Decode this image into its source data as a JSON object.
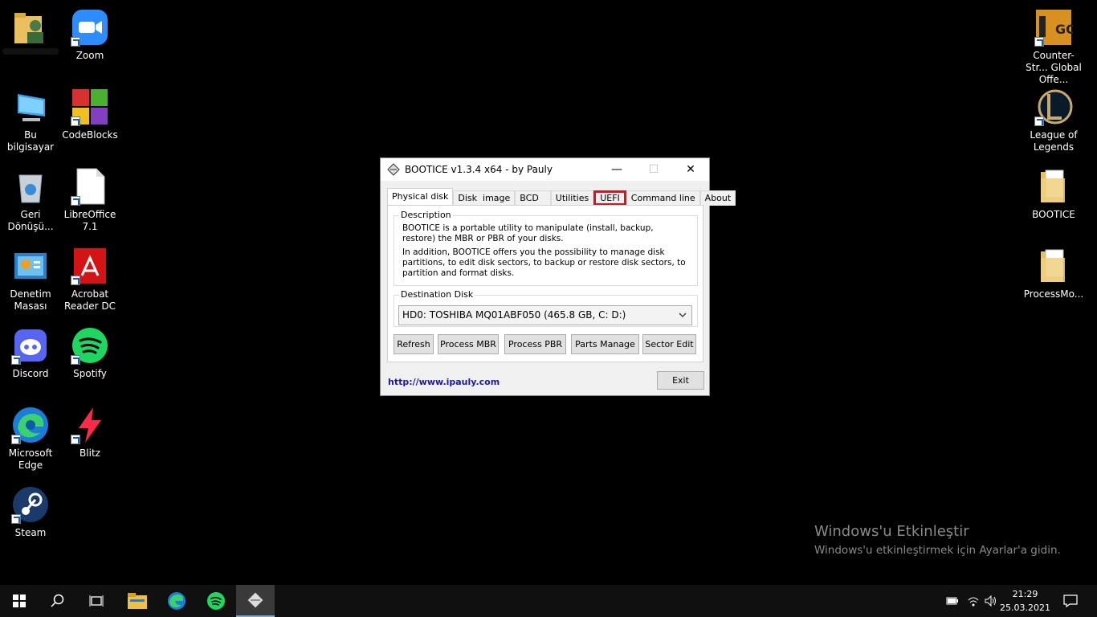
{
  "desktop_icons_left": [
    {
      "label": ""
    },
    {
      "label": "Zoom"
    },
    {
      "label": "Bu bilgisayar"
    },
    {
      "label": "CodeBlocks"
    },
    {
      "label": "Geri Dönüşü..."
    },
    {
      "label": "LibreOffice 7.1"
    },
    {
      "label": "Denetim Masası"
    },
    {
      "label": "Acrobat Reader DC"
    },
    {
      "label": "Discord"
    },
    {
      "label": "Spotify"
    },
    {
      "label": "Microsoft Edge"
    },
    {
      "label": "Blitz"
    },
    {
      "label": "Steam"
    }
  ],
  "desktop_icons_right": [
    {
      "label": "Counter-Str... Global Offe..."
    },
    {
      "label": "League of Legends"
    },
    {
      "label": "BOOTICE"
    },
    {
      "label": "ProcessMo..."
    }
  ],
  "window": {
    "title": "BOOTICE v1.3.4 x64 - by Pauly",
    "tabs": [
      {
        "label": "Physical disk"
      },
      {
        "label": "Disk  image"
      },
      {
        "label": "BCD"
      },
      {
        "label": "Utilities"
      },
      {
        "label": "UEFI"
      },
      {
        "label": "Command line"
      },
      {
        "label": "About"
      }
    ],
    "description_legend": "Description",
    "description_p1": "BOOTICE is a portable utility to manipulate (install, backup, restore) the MBR or PBR of your disks.",
    "description_p2": "In addition, BOOTICE offers you the possibility to manage disk partitions, to edit disk sectors, to backup or restore disk sectors, to partition and format disks.",
    "destination_legend": "Destination Disk",
    "destination_value": "HD0: TOSHIBA MQ01ABF050 (465.8 GB, C: D:)",
    "buttons": {
      "refresh": "Refresh",
      "process_mbr": "Process MBR",
      "process_pbr": "Process PBR",
      "parts_manage": "Parts Manage",
      "sector_edit": "Sector Edit",
      "exit": "Exit"
    },
    "link": "http://www.ipauly.com",
    "highlight_color": "#e01020"
  },
  "watermark": {
    "title": "Windows'u Etkinleştir",
    "subtitle": "Windows'u etkinleştirmek için Ayarlar'a gidin."
  },
  "taskbar": {
    "time": "21:29",
    "date": "25.03.2021"
  }
}
